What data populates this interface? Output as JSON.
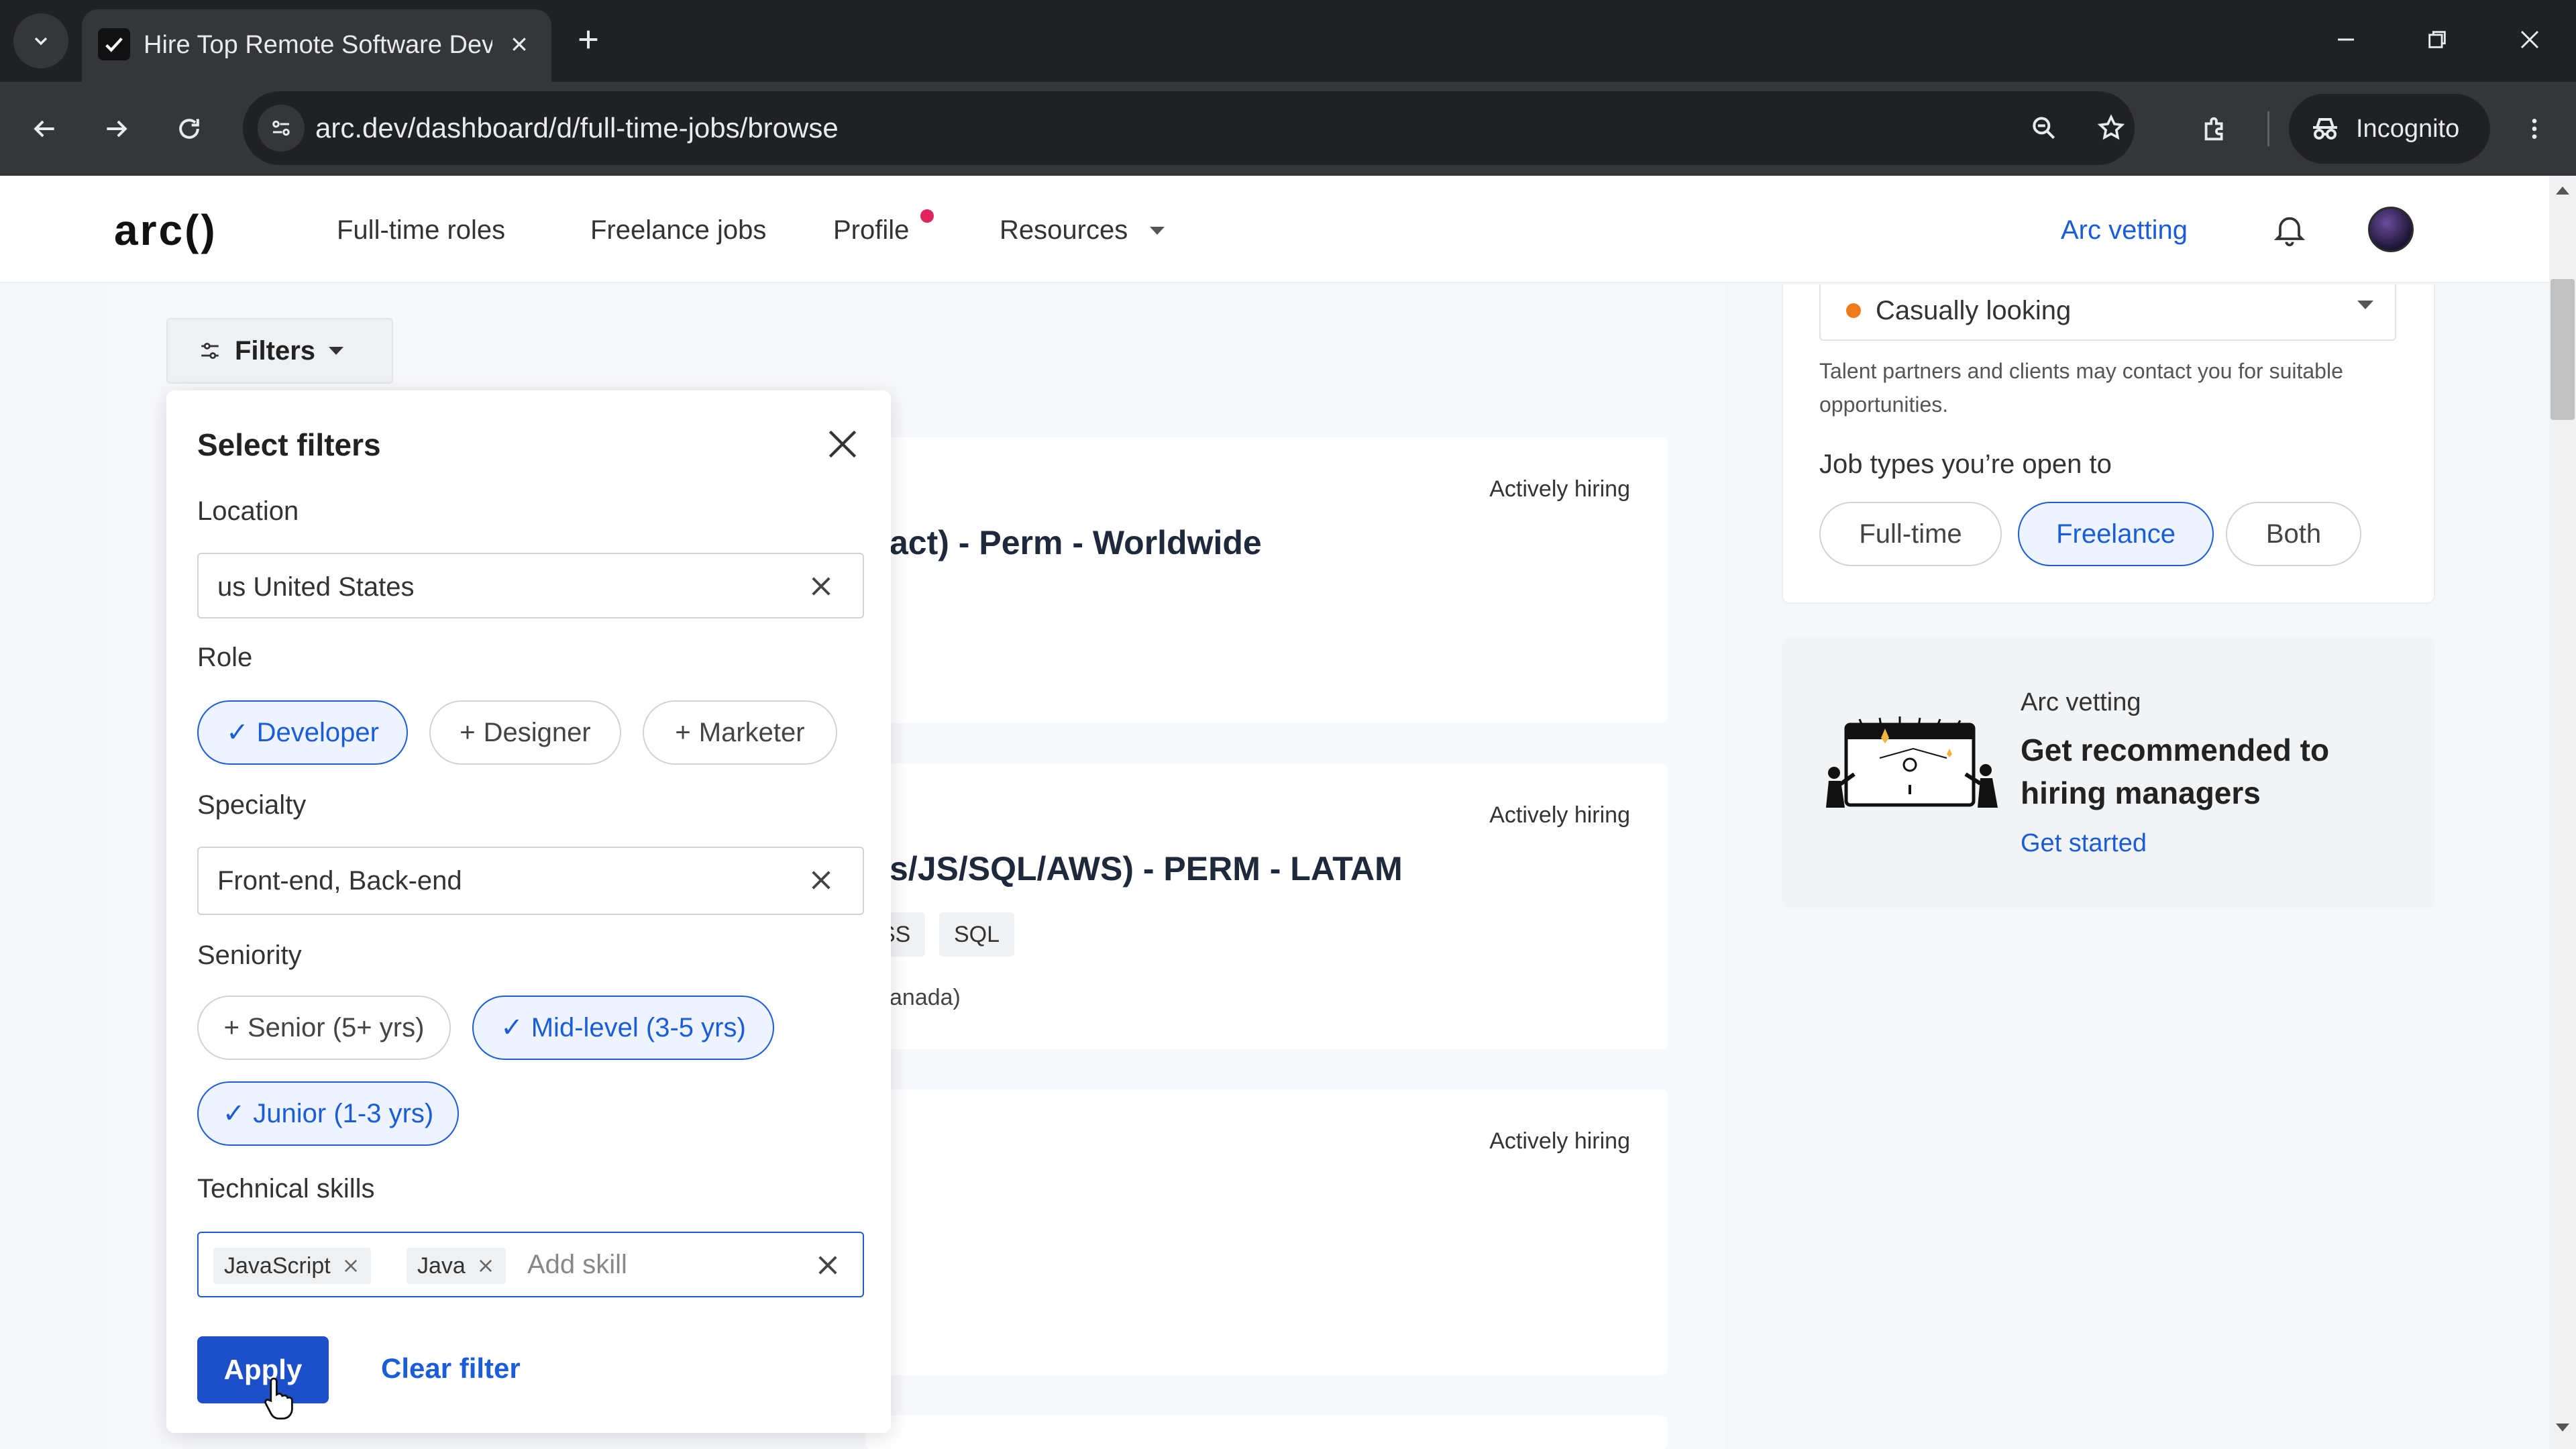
{
  "browser": {
    "tab_title": "Hire Top Remote Software Deve",
    "url": "arc.dev/dashboard/d/full-time-jobs/browse",
    "incognito_label": "Incognito"
  },
  "header": {
    "logo": "arc()",
    "nav": [
      "Full-time roles",
      "Freelance jobs",
      "Profile",
      "Resources"
    ],
    "arc_vetting": "Arc vetting"
  },
  "filters_button": "Filters",
  "filter_panel": {
    "title": "Select filters",
    "location_label": "Location",
    "location_value": "us United States",
    "role_label": "Role",
    "roles": [
      {
        "label": "Developer",
        "mark": "✓"
      },
      {
        "label": "Designer",
        "mark": "+"
      },
      {
        "label": "Marketer",
        "mark": "+"
      }
    ],
    "specialty_label": "Specialty",
    "specialty_value": "Front-end, Back-end",
    "seniority_label": "Seniority",
    "seniority": [
      {
        "label": "Senior (5+ yrs)",
        "mark": "+"
      },
      {
        "label": "Mid-level (3-5 yrs)",
        "mark": "✓"
      },
      {
        "label": "Junior (1-3 yrs)",
        "mark": "✓"
      }
    ],
    "skills_label": "Technical skills",
    "skills": [
      "JavaScript",
      "Java"
    ],
    "skills_placeholder": "Add skill",
    "apply": "Apply",
    "clear": "Clear filter"
  },
  "jobs": [
    {
      "hiring": "Actively hiring",
      "title": "act) - Perm - Worldwide"
    },
    {
      "hiring": "Actively hiring",
      "title": "s/JS/SQL/AWS) - PERM - LATAM",
      "tags": [
        "SS",
        "SQL"
      ],
      "location": "anada)"
    },
    {
      "hiring": "Actively hiring"
    }
  ],
  "sidebar": {
    "status": "Casually looking",
    "status_desc": "Talent partners and clients may contact you for suitable opportunities.",
    "job_types_label": "Job types you’re open to",
    "job_types": [
      "Full-time",
      "Freelance",
      "Both"
    ],
    "vetting_label": "Arc vetting",
    "vetting_title": "Get recommended to hiring managers",
    "vetting_link": "Get started"
  }
}
